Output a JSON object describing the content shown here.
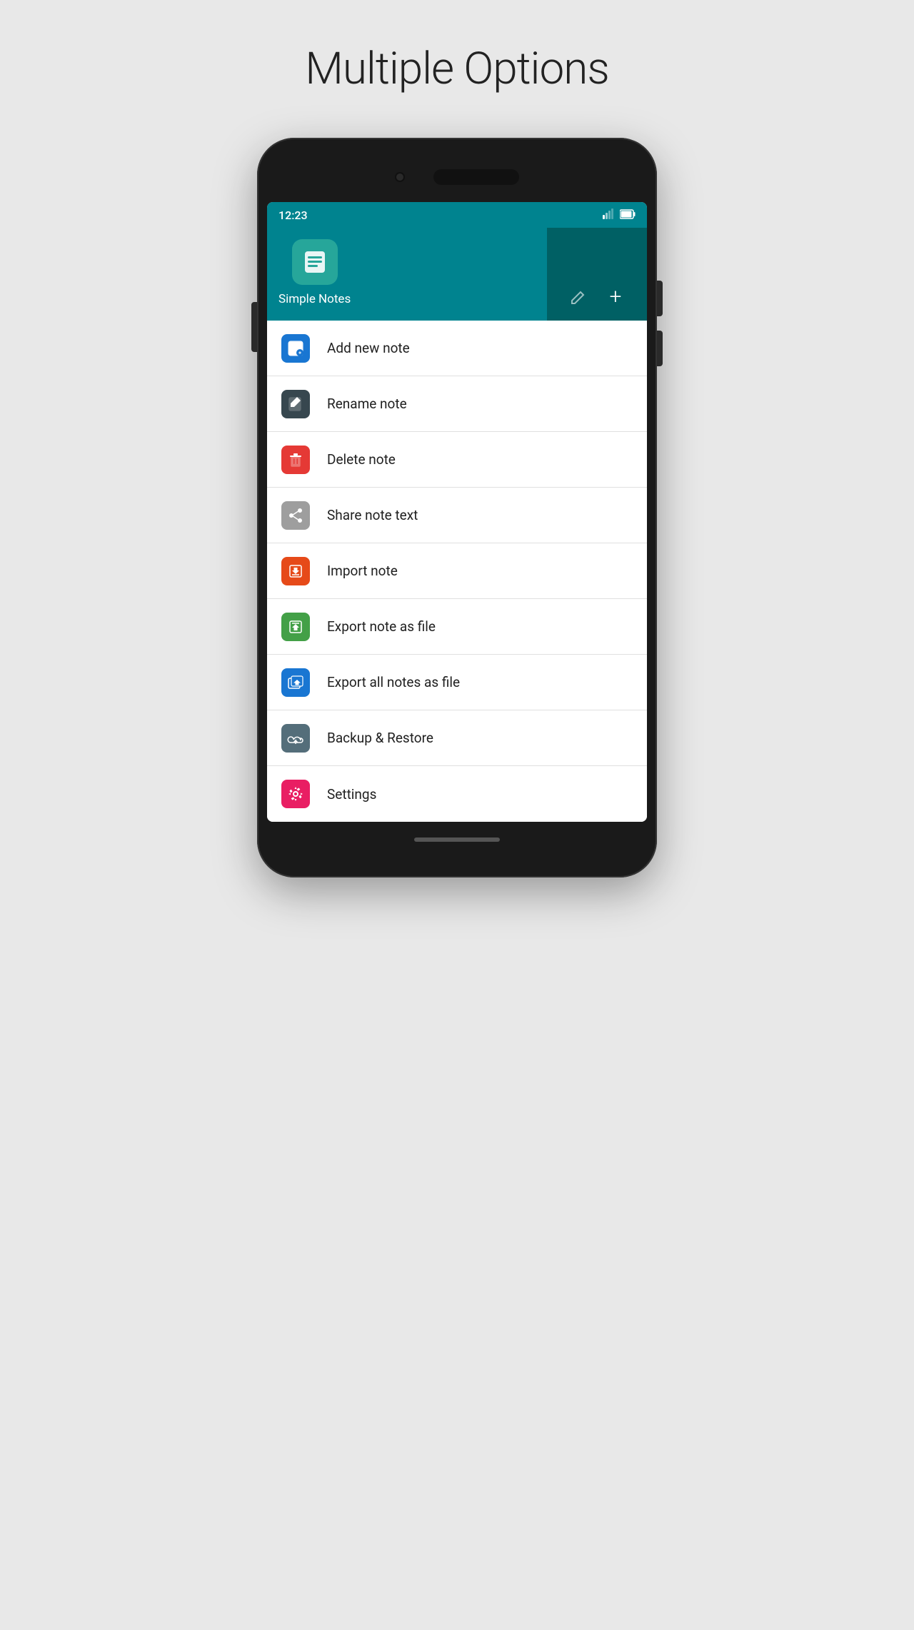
{
  "page": {
    "title": "Multiple Options"
  },
  "statusBar": {
    "time": "12:23",
    "signalIcon": "signal",
    "batteryIcon": "battery"
  },
  "appHeader": {
    "appName": "Simple Notes",
    "editIcon": "✏",
    "addIcon": "+"
  },
  "menuItems": [
    {
      "id": "add-new-note",
      "label": "Add new note",
      "iconColor": "icon-blue",
      "iconType": "add-note"
    },
    {
      "id": "rename-note",
      "label": "Rename note",
      "iconColor": "icon-dark",
      "iconType": "rename-note"
    },
    {
      "id": "delete-note",
      "label": "Delete note",
      "iconColor": "icon-red",
      "iconType": "delete-note"
    },
    {
      "id": "share-note-text",
      "label": "Share note text",
      "iconColor": "icon-share",
      "iconType": "share"
    },
    {
      "id": "import-note",
      "label": "Import note",
      "iconColor": "icon-orange",
      "iconType": "import-note"
    },
    {
      "id": "export-note-as-file",
      "label": "Export note as file",
      "iconColor": "icon-green",
      "iconType": "export-note"
    },
    {
      "id": "export-all-notes-as-file",
      "label": "Export all notes as file",
      "iconColor": "icon-blue-upload",
      "iconType": "export-all"
    },
    {
      "id": "backup-restore",
      "label": "Backup & Restore",
      "iconColor": "icon-dark-cloud",
      "iconType": "backup"
    },
    {
      "id": "settings",
      "label": "Settings",
      "iconColor": "icon-pink",
      "iconType": "settings"
    }
  ]
}
